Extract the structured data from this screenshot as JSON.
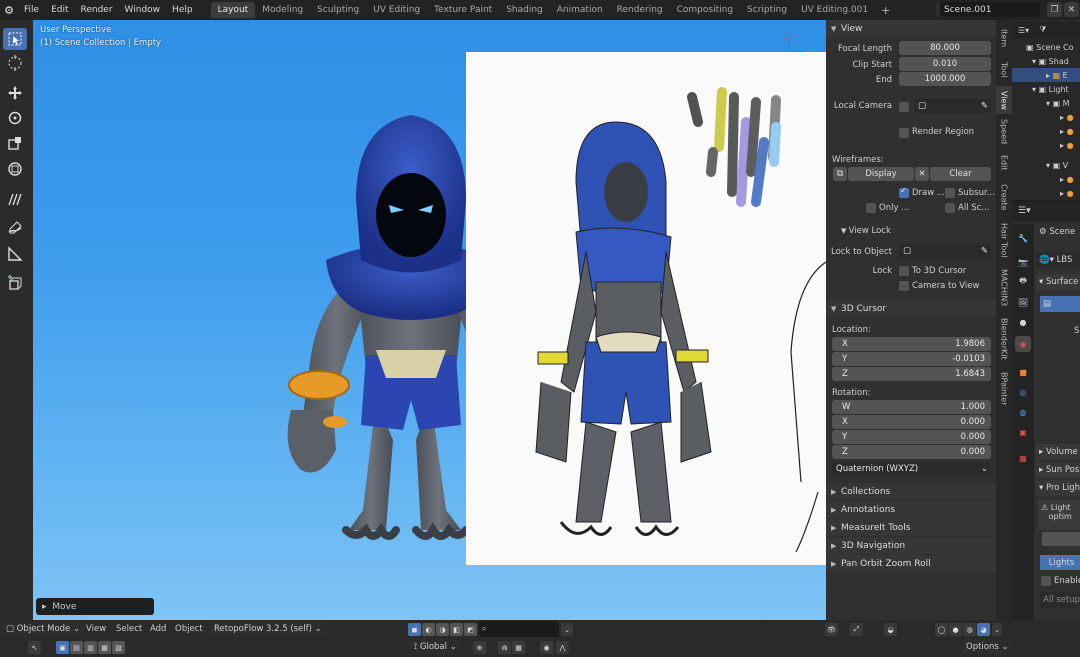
{
  "topbar": {
    "menus": [
      "File",
      "Edit",
      "Render",
      "Window",
      "Help"
    ],
    "workspace_tabs": [
      "Layout",
      "Modeling",
      "Sculpting",
      "UV Editing",
      "Texture Paint",
      "Shading",
      "Animation",
      "Rendering",
      "Compositing",
      "Scripting",
      "UV Editing.001"
    ],
    "active_tab": "Layout",
    "add_tab": "+",
    "scene_name": "Scene.001"
  },
  "viewport": {
    "perspective": "User Perspective",
    "collection_info": "(1) Scene Collection | Empty",
    "last_operator": "Move"
  },
  "npanel": {
    "view_header": "View",
    "focal_length_label": "Focal Length",
    "focal_length": "80.000",
    "clip_start_label": "Clip Start",
    "clip_start": "0.010",
    "end_label": "End",
    "end": "1000.000",
    "local_camera_label": "Local Camera",
    "render_region_label": "Render Region",
    "wireframes_label": "Wireframes:",
    "display_label": "Display",
    "clear_label": "Clear",
    "draw_label": "Draw ...",
    "subsurf_label": "Subsur...",
    "only_label": "Only ...",
    "all_sc_label": "All Sc...",
    "view_lock_header": "View Lock",
    "lock_to_object_label": "Lock to Object",
    "lock_label": "Lock",
    "to_3d_cursor_label": "To 3D Cursor",
    "camera_to_view_label": "Camera to View",
    "cursor_header": "3D Cursor",
    "location_label": "Location:",
    "loc_x": "1.9806",
    "loc_y": "-0.0103",
    "loc_z": "1.6843",
    "rotation_label": "Rotation:",
    "rot_w": "1.000",
    "rot_x": "0.000",
    "rot_y": "0.000",
    "rot_z": "0.000",
    "rotation_mode": "Quaternion (WXYZ)",
    "axis_x": "X",
    "axis_y": "Y",
    "axis_z": "Z",
    "axis_w": "W",
    "collapsed_sections": [
      "Collections",
      "Annotations",
      "MeasureIt Tools",
      "3D Navigation",
      "Pan Orbit Zoom Roll"
    ]
  },
  "ntabs": [
    "Item",
    "Tool",
    "View",
    "Speed",
    "Edit",
    "Create",
    "Hair Tool",
    "MACHIN3",
    "BlenderKit",
    "BPainter"
  ],
  "outliner": {
    "rows": [
      "Scene Co",
      "Shad",
      "E",
      "Light",
      "M",
      "",
      "",
      "",
      "V",
      "",
      ""
    ]
  },
  "properties": {
    "scene_label": "Scene",
    "world_label": "LBS",
    "surface_label": "Surface",
    "volume_label": "Volume",
    "sun_pos_label": "Sun Pos",
    "pro_light_label": "Pro Ligh",
    "warning_text": "Light",
    "warning_text2": "optim",
    "lights_btn": "Lights",
    "enable_label": "Enable",
    "all_setup_label": "All setup",
    "s_label": "S"
  },
  "bottombar": {
    "mode": "Object Mode",
    "menus": [
      "View",
      "Select",
      "Add",
      "Object"
    ],
    "addon": "RetopoFlow 3.2.5 (self)",
    "transform_orientation": "Global",
    "options": "Options"
  },
  "colors": {
    "accent": "#4772b3",
    "sky_top": "#2f8fe6",
    "sky_bottom": "#7ec4f4"
  }
}
